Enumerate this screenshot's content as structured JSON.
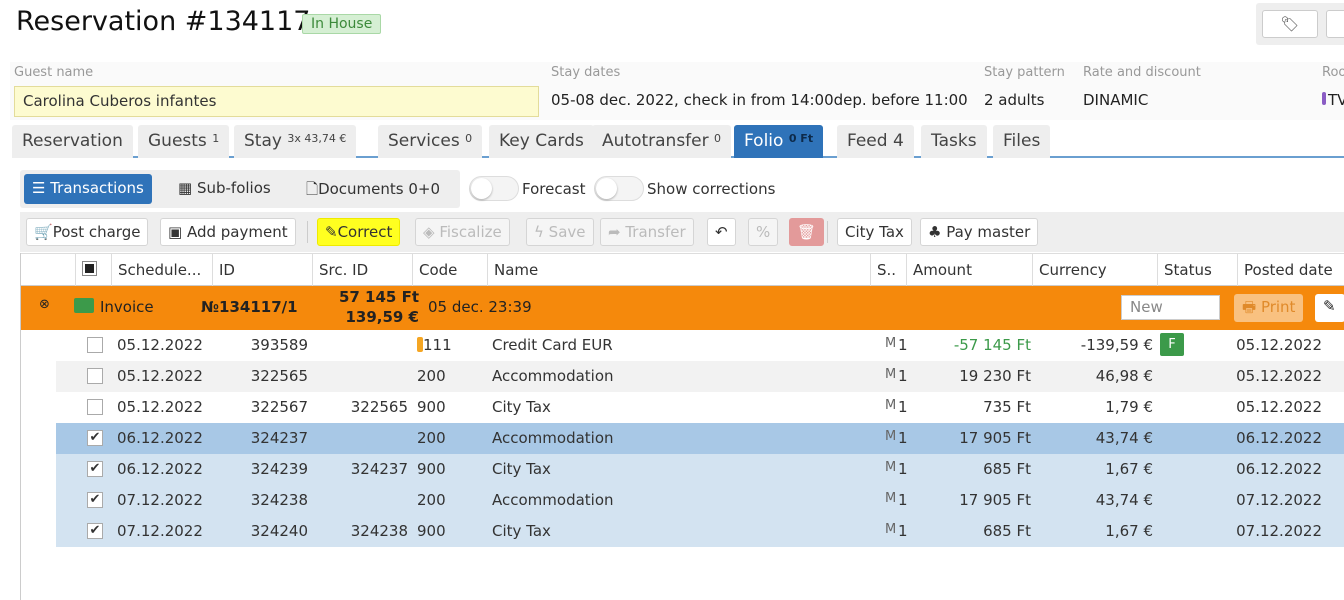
{
  "header": {
    "title": "Reservation #134117",
    "status": "In House",
    "tag_icon": "tag-icon"
  },
  "info": {
    "guest_label": "Guest name",
    "guest_value": "Carolina Cuberos infantes",
    "stay_label": "Stay dates",
    "stay_value": "05-08 dec. 2022, check in from 14:00dep. before 11:00",
    "pattern_label": "Stay pattern",
    "pattern_value": "2 adults",
    "rate_label": "Rate and discount",
    "rate_value": "DINAMIC",
    "room_label": "Roo",
    "room_value": "TV"
  },
  "tabs": [
    {
      "label": "Reservation",
      "badge": ""
    },
    {
      "label": "Guests",
      "badge": "1"
    },
    {
      "label": "Stay",
      "badge": "3x 43,74 €"
    },
    {
      "label": "Services",
      "badge": "0"
    },
    {
      "label": "Key Cards",
      "badge": ""
    },
    {
      "label": "Autotransfer",
      "badge": "0"
    },
    {
      "label": "Folio",
      "badge": "0 Ft"
    },
    {
      "label": "Feed 4",
      "badge": ""
    },
    {
      "label": "Tasks",
      "badge": ""
    },
    {
      "label": "Files",
      "badge": ""
    }
  ],
  "subtabs": {
    "transactions": "Transactions",
    "subfolios": "Sub-folios",
    "documents": "Documents 0+0",
    "forecast": "Forecast",
    "corrections": "Show corrections"
  },
  "toolbar": {
    "post_charge": "Post charge",
    "add_payment": "Add payment",
    "correct": "Correct",
    "fiscalize": "Fiscalize",
    "save": "Save",
    "transfer": "Transfer",
    "percent": "%",
    "city_tax": "City Tax",
    "pay_master": "Pay master"
  },
  "columns": [
    "Schedule...",
    "ID",
    "Src. ID",
    "Code",
    "Name",
    "S..",
    "Amount",
    "Currency",
    "Status",
    "Posted date"
  ],
  "invoice": {
    "label": "Invoice",
    "number": "№134117/1",
    "amount_ft": "57 145 Ft",
    "amount_eur": "139,59 €",
    "date": "05 dec. 23:39",
    "status_placeholder": "New",
    "print": "Print"
  },
  "rows": [
    {
      "checked": false,
      "date": "05.12.2022",
      "id": "393589",
      "src": "",
      "code": "111",
      "name": "Credit Card EUR",
      "s": "1",
      "amount": "-57 145 Ft",
      "currency": "-139,59 €",
      "status": "F",
      "posted": "05.12.2022"
    },
    {
      "checked": false,
      "date": "05.12.2022",
      "id": "322565",
      "src": "",
      "code": "200",
      "name": "Accommodation",
      "s": "1",
      "amount": "19 230 Ft",
      "currency": "46,98 €",
      "status": "",
      "posted": "05.12.2022"
    },
    {
      "checked": false,
      "date": "05.12.2022",
      "id": "322567",
      "src": "322565",
      "code": "900",
      "name": "City Tax",
      "s": "1",
      "amount": "735 Ft",
      "currency": "1,79 €",
      "status": "",
      "posted": "05.12.2022"
    },
    {
      "checked": true,
      "date": "06.12.2022",
      "id": "324237",
      "src": "",
      "code": "200",
      "name": "Accommodation",
      "s": "1",
      "amount": "17 905 Ft",
      "currency": "43,74 €",
      "status": "",
      "posted": "06.12.2022"
    },
    {
      "checked": true,
      "date": "06.12.2022",
      "id": "324239",
      "src": "324237",
      "code": "900",
      "name": "City Tax",
      "s": "1",
      "amount": "685 Ft",
      "currency": "1,67 €",
      "status": "",
      "posted": "06.12.2022"
    },
    {
      "checked": true,
      "date": "07.12.2022",
      "id": "324238",
      "src": "",
      "code": "200",
      "name": "Accommodation",
      "s": "1",
      "amount": "17 905 Ft",
      "currency": "43,74 €",
      "status": "",
      "posted": "07.12.2022"
    },
    {
      "checked": true,
      "date": "07.12.2022",
      "id": "324240",
      "src": "324238",
      "code": "900",
      "name": "City Tax",
      "s": "1",
      "amount": "685 Ft",
      "currency": "1,67 €",
      "status": "",
      "posted": "07.12.2022"
    }
  ],
  "colors": {
    "accent": "#2f73b9",
    "invoice": "#f5890c",
    "selected": "#a8c8e6",
    "checked_row": "#d3e3f1",
    "highlight": "#ffff20",
    "negative": "#3c9a4a"
  }
}
